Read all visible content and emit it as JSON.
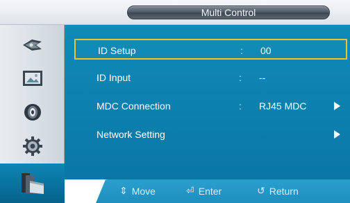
{
  "header": {
    "title": "Multi Control"
  },
  "sidebar": {
    "items": [
      {
        "icon": "picture-icon"
      },
      {
        "icon": "picture-frame-icon"
      },
      {
        "icon": "sound-icon"
      },
      {
        "icon": "setup-gear-icon"
      },
      {
        "icon": "multi-control-icon",
        "active": true
      }
    ]
  },
  "menu": {
    "rows": [
      {
        "label": "ID Setup",
        "colon": ":",
        "value": "00",
        "selected": true
      },
      {
        "label": "ID Input",
        "colon": ":",
        "value": "--"
      },
      {
        "label": "MDC Connection",
        "colon": ":",
        "value": "RJ45 MDC",
        "submenu": true
      },
      {
        "label": "Network Setting",
        "colon": ":",
        "value": "",
        "submenu": true
      }
    ]
  },
  "footer": {
    "move": {
      "glyph": "⇕",
      "label": "Move"
    },
    "enter": {
      "glyph": "⏎",
      "label": "Enter"
    },
    "return": {
      "glyph": "↺",
      "label": "Return"
    }
  },
  "colors": {
    "panel": "#0a7fae",
    "highlight_border": "#f2c32a",
    "sidebar_active": "#05628b"
  }
}
